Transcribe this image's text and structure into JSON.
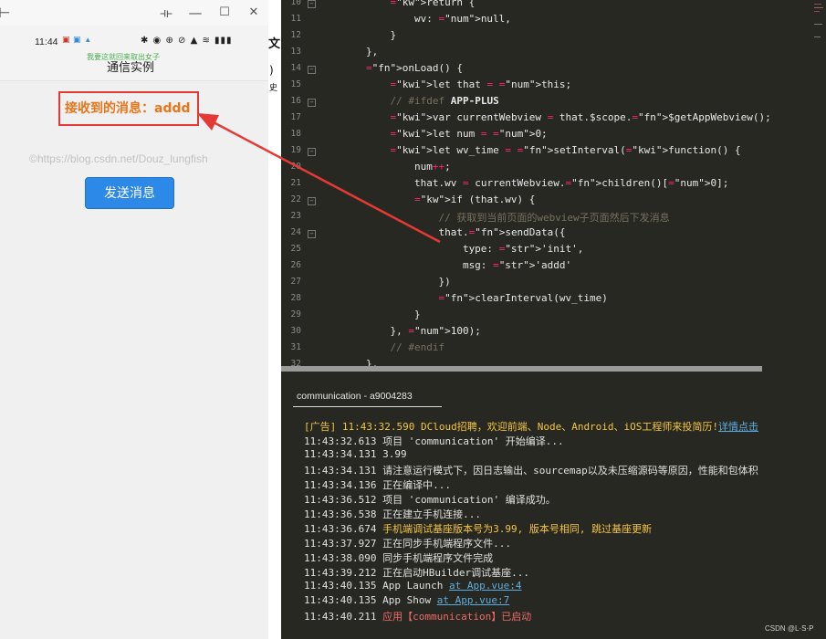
{
  "phone": {
    "window_buttons": {
      "pin": "⊣⊢",
      "minimize": "—",
      "maximize": "☐",
      "close": "✕"
    },
    "status_time": "11:44",
    "status_icons": "✱ ◉ ⊕ ⊘ ▲ ≋ ▮▮▮",
    "notification_text": "我要这就回来取出女子",
    "nav_title": "通信实例",
    "received_label": "接收到的消息：",
    "received_value": "addd",
    "watermark": "©https://blog.csdn.net/Douz_lungfish",
    "send_button": "发送消息"
  },
  "gap_glyphs": {
    "g1": "文",
    "g2": ")",
    "g3": "史"
  },
  "editor": {
    "line_numbers": [
      "10",
      "11",
      "12",
      "13",
      "14",
      "15",
      "16",
      "17",
      "18",
      "19",
      "20",
      "21",
      "22",
      "23",
      "24",
      "25",
      "26",
      "27",
      "28",
      "29",
      "30",
      "31",
      "32"
    ],
    "lines": [
      "            return {",
      "                wv: null,",
      "            }",
      "        },",
      "        onLoad() {",
      "            let that = this;",
      "            // #ifdef APP-PLUS",
      "            var currentWebview = that.$scope.$getAppWebview();",
      "            let num = 0;",
      "            let wv_time = setInterval(function() {",
      "                num++;",
      "                that.wv = currentWebview.children()[0];",
      "                if (that.wv) {",
      "                    // 获取到当前页面的webview子页面然后下发消息",
      "                    that.sendData({",
      "                        type: 'init',",
      "                        msg: 'addd'",
      "                    })",
      "                    clearInterval(wv_time)",
      "                }",
      "            }, 100);",
      "            // #endif",
      "        },"
    ]
  },
  "console": {
    "tab_title": "communication - a9004283",
    "logs": [
      {
        "time": "[广告] 11:43:32.590",
        "text": "DCloud招聘，欢迎前端、Node、Android、iOS工程师来投简历!",
        "link": "详情点击"
      },
      {
        "time": "11:43:32.613",
        "text": "项目 'communication' 开始编译..."
      },
      {
        "time": "11:43:34.131",
        "text": "3.99"
      },
      {
        "time": "11:43:34.131",
        "text": "请注意运行模式下，因日志输出、sourcemap以及未压缩源码等原因，性能和包体积"
      },
      {
        "time": "11:43:34.136",
        "text": "正在编译中..."
      },
      {
        "time": "11:43:36.512",
        "text": "项目 'communication' 编译成功。"
      },
      {
        "time": "11:43:36.538",
        "text": "正在建立手机连接..."
      },
      {
        "time": "11:43:36.674",
        "text": "手机端调试基座版本号为3.99, 版本号相同, 跳过基座更新"
      },
      {
        "time": "11:43:37.927",
        "text": "正在同步手机端程序文件..."
      },
      {
        "time": "11:43:38.090",
        "text": "同步手机端程序文件完成"
      },
      {
        "time": "11:43:39.212",
        "text": "正在启动HBuilder调试基座..."
      },
      {
        "time": "11:43:40.135",
        "text": "App Launch",
        "link": "at App.vue:4"
      },
      {
        "time": "11:43:40.135",
        "text": "App Show",
        "link": "at App.vue:7"
      },
      {
        "time": "11:43:40.211",
        "text": "应用【communication】已启动"
      }
    ]
  },
  "footer_watermark": "CSDN @L·S·P",
  "colors": {
    "accent_red": "#e53935",
    "message_orange": "#e8751a",
    "button_blue": "#2d89e8",
    "editor_bg": "#272822"
  }
}
